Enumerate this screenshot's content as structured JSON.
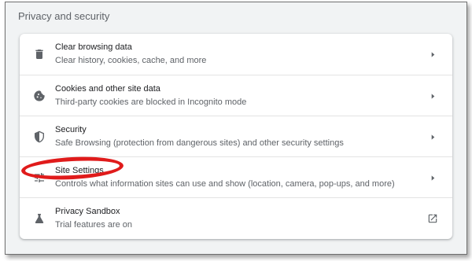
{
  "section": {
    "title": "Privacy and security"
  },
  "items": [
    {
      "title": "Clear browsing data",
      "subtitle": "Clear history, cookies, cache, and more",
      "icon": "trash-icon",
      "end_icon": "chevron-right-icon"
    },
    {
      "title": "Cookies and other site data",
      "subtitle": "Third-party cookies are blocked in Incognito mode",
      "icon": "cookie-icon",
      "end_icon": "chevron-right-icon"
    },
    {
      "title": "Security",
      "subtitle": "Safe Browsing (protection from dangerous sites) and other security settings",
      "icon": "shield-icon",
      "end_icon": "chevron-right-icon"
    },
    {
      "title": "Site Settings",
      "subtitle": "Controls what information sites can use and show (location, camera, pop-ups, and more)",
      "icon": "tune-icon",
      "end_icon": "chevron-right-icon"
    },
    {
      "title": "Privacy Sandbox",
      "subtitle": "Trial features are on",
      "icon": "flask-icon",
      "end_icon": "open-in-new-icon"
    }
  ],
  "colors": {
    "highlight": "#e01b1b",
    "background": "#f1f3f4",
    "card": "#ffffff"
  }
}
